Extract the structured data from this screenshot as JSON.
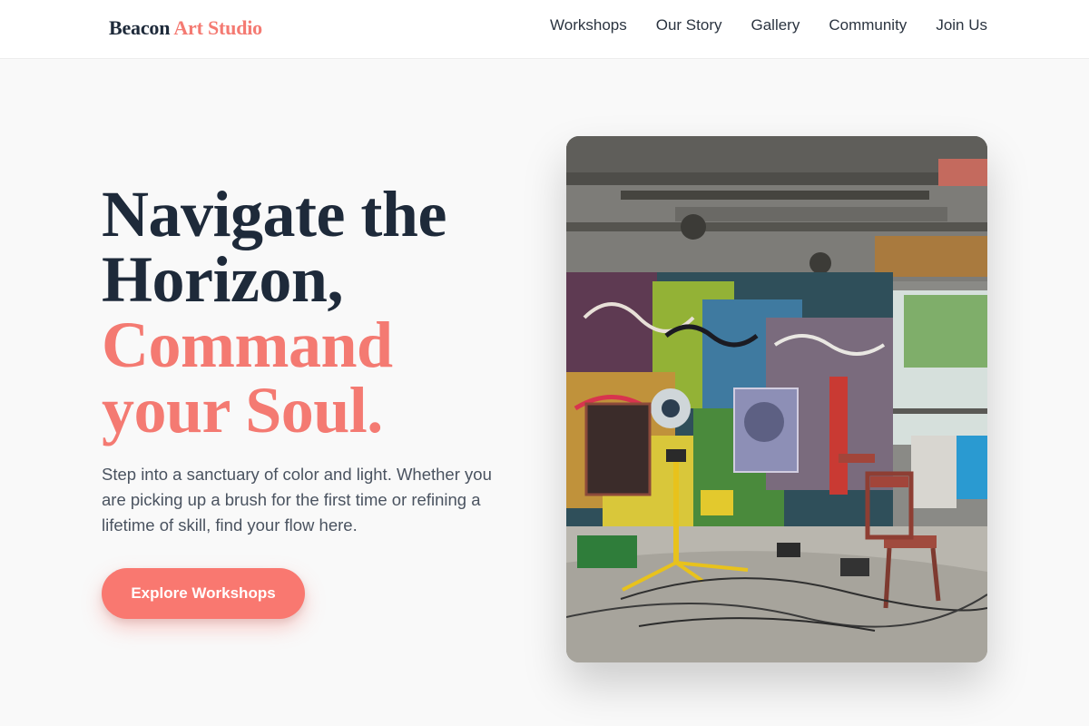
{
  "brand": {
    "name_part1": "Beacon",
    "name_part2": "Art Studio"
  },
  "nav": {
    "items": [
      {
        "label": "Workshops"
      },
      {
        "label": "Our Story"
      },
      {
        "label": "Gallery"
      },
      {
        "label": "Community"
      },
      {
        "label": "Join Us"
      }
    ]
  },
  "hero": {
    "title_line1": "Navigate the",
    "title_line2": "Horizon,",
    "title_line3": "Command",
    "title_line4": "your Soul.",
    "subtitle": "Step into a sanctuary of color and light. Whether you are picking up a brush for the first time or refining a lifetime of skill, find your flow here.",
    "cta_label": "Explore Workshops"
  },
  "colors": {
    "accent": "#f47a72",
    "cta": "#f97870",
    "ink": "#1e2a3a",
    "background": "#f9f9f9"
  }
}
